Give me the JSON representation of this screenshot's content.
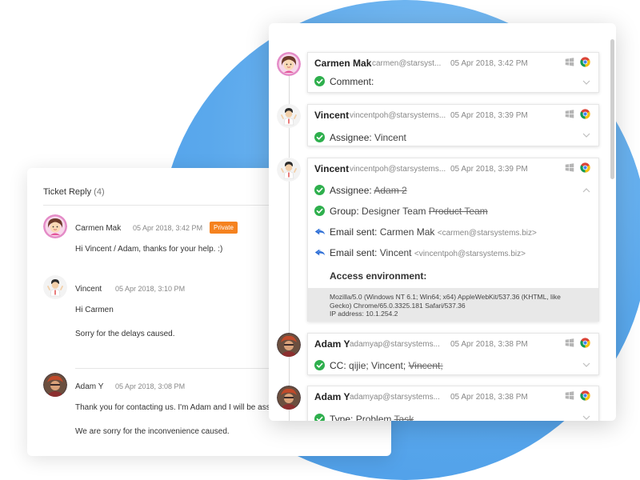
{
  "ticket_reply": {
    "title": "Ticket Reply",
    "count": "(4)",
    "replies": [
      {
        "name": "Carmen Mak",
        "date": "05 Apr 2018, 3:42 PM",
        "badge": "Private",
        "lines": [
          "Hi Vincent / Adam, thanks for your help. :)"
        ]
      },
      {
        "name": "Vincent",
        "date": "05 Apr 2018, 3:10 PM",
        "lines": [
          "Hi Carmen",
          "Sorry for the delays caused."
        ]
      },
      {
        "name": "Adam Y",
        "date": "05 Apr 2018, 3:08 PM",
        "lines": [
          "Thank you for contacting us. I'm Adam and I will be assis",
          "We are sorry for the inconvenience caused."
        ]
      }
    ]
  },
  "activity": {
    "entries": [
      {
        "name": "Carmen Mak",
        "email": "carmen@starsyst...",
        "date": "05 Apr 2018, 3:42 PM",
        "changes": [
          {
            "label": "Comment:",
            "value": "",
            "old": ""
          }
        ]
      },
      {
        "name": "Vincent",
        "email": "vincentpoh@starsystems...",
        "date": "05 Apr 2018, 3:39 PM",
        "changes": [
          {
            "label": "Assignee:",
            "value": "Vincent",
            "old": ""
          }
        ]
      },
      {
        "name": "Vincent",
        "email": "vincentpoh@starsystems...",
        "date": "05 Apr 2018, 3:39 PM",
        "changes": [
          {
            "label": "Assignee:",
            "value": "",
            "old": "Adam 2"
          },
          {
            "label": "Group:",
            "value": "Designer Team",
            "old": "Product Team"
          }
        ],
        "emails": [
          {
            "label": "Email sent:",
            "value": "Carmen Mak",
            "address": "<carmen@starsystems.biz>"
          },
          {
            "label": "Email sent:",
            "value": "Vincent",
            "address": "<vincentpoh@starsystems.biz>"
          }
        ],
        "environment": {
          "title": "Access environment:",
          "line1": "Mozilla/5.0 (Windows NT 6.1; Win64; x64) AppleWebKit/537.36 (KHTML, like",
          "line2": "Gecko) Chrome/65.0.3325.181 Safari/537.36",
          "line3": "IP address: 10.1.254.2"
        }
      },
      {
        "name": "Adam Y",
        "email": "adamyap@starsystems...",
        "date": "05 Apr 2018, 3:38 PM",
        "changes": [
          {
            "label": "CC:",
            "value": "qijie; Vincent;",
            "old": "Vincent;"
          }
        ]
      },
      {
        "name": "Adam Y",
        "email": "adamyap@starsystems...",
        "date": "05 Apr 2018, 3:38 PM",
        "changes": [
          {
            "label": "Type:",
            "value": "Problem",
            "old": "Task"
          }
        ]
      }
    ]
  },
  "colors": {
    "check_green": "#2eaf4d",
    "badge_orange": "#f5821f",
    "mail_blue": "#2f6fd6",
    "circle_blue": "#5aa8ec"
  },
  "icons": [
    "windows-icon",
    "chrome-icon",
    "check-circle-icon",
    "email-sent-icon",
    "chevron-down-icon",
    "chevron-up-icon"
  ]
}
